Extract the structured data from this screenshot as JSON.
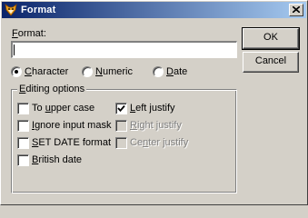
{
  "window": {
    "title": "Format",
    "app_icon": "fox-icon",
    "close_icon": "close-icon"
  },
  "format": {
    "label_pre": "",
    "label_mnemonic": "F",
    "label_post": "ormat:",
    "value": ""
  },
  "buttons": {
    "ok": "OK",
    "cancel": "Cancel"
  },
  "radios": [
    {
      "pre": "",
      "mn": "C",
      "post": "haracter",
      "selected": true
    },
    {
      "pre": "",
      "mn": "N",
      "post": "umeric",
      "selected": false
    },
    {
      "pre": "",
      "mn": "D",
      "post": "ate",
      "selected": false
    }
  ],
  "editing": {
    "title_pre": "",
    "title_mn": "E",
    "title_post": "diting options",
    "left": [
      {
        "pre": "To ",
        "mn": "u",
        "post": "pper case",
        "checked": false,
        "enabled": true
      },
      {
        "pre": "",
        "mn": "I",
        "post": "gnore input mask",
        "checked": false,
        "enabled": true
      },
      {
        "pre": "",
        "mn": "S",
        "post": "ET DATE format",
        "checked": false,
        "enabled": true
      },
      {
        "pre": "",
        "mn": "B",
        "post": "ritish date",
        "checked": false,
        "enabled": true
      }
    ],
    "right": [
      {
        "pre": "",
        "mn": "L",
        "post": "eft justify",
        "checked": true,
        "enabled": true
      },
      {
        "pre": "",
        "mn": "R",
        "post": "ight justify",
        "checked": false,
        "enabled": false
      },
      {
        "pre": "Ce",
        "mn": "n",
        "post": "ter justify",
        "checked": false,
        "enabled": false
      }
    ]
  }
}
